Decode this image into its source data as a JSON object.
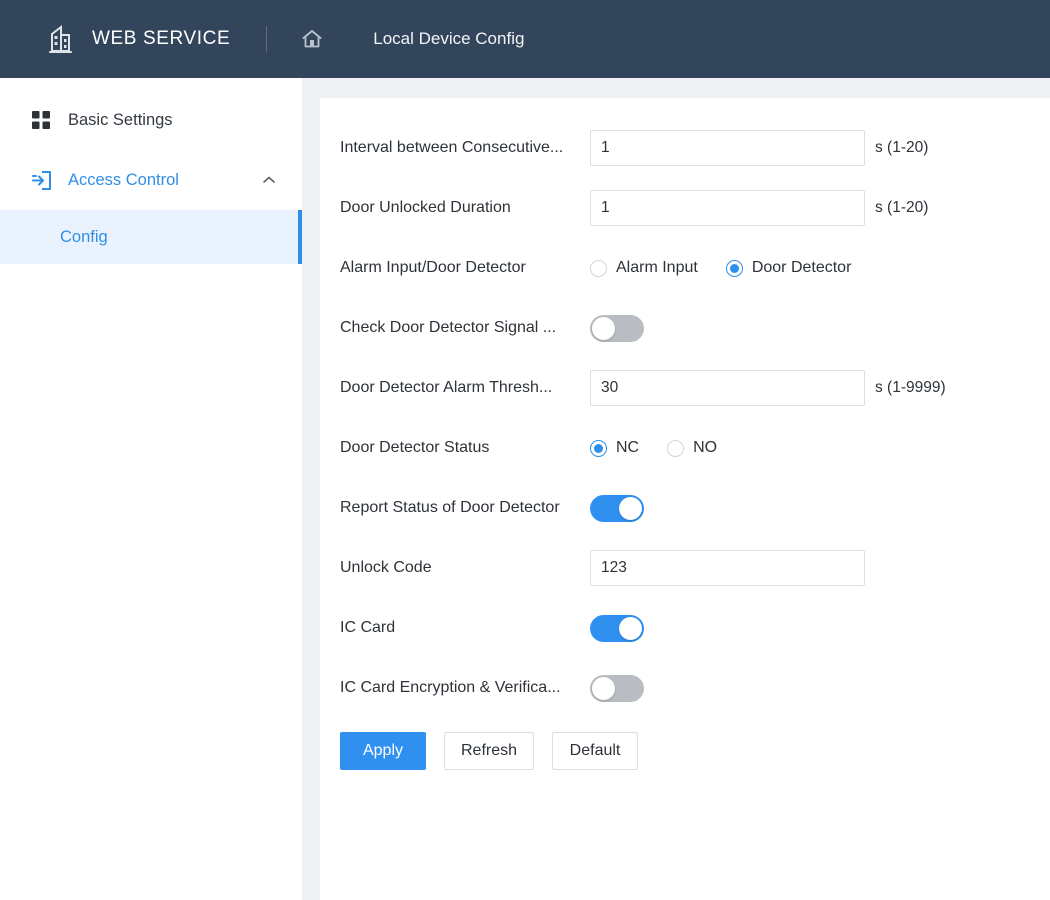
{
  "header": {
    "brand_icon": "building-icon",
    "brand_name": "WEB SERVICE",
    "home_icon": "home-icon",
    "page_title": "Local Device Config"
  },
  "sidebar": {
    "items": [
      {
        "label": "Basic Settings",
        "icon": "grid-squares-icon",
        "active": false,
        "expandable": false
      },
      {
        "label": "Access Control",
        "icon": "sign-in-box-icon",
        "active": true,
        "expandable": true,
        "chevron": "chevron-up-icon",
        "children": [
          {
            "label": "Config",
            "selected": true
          }
        ]
      }
    ]
  },
  "form": {
    "rows": [
      {
        "label": "Interval between Consecutive...",
        "type": "input",
        "value": "1",
        "unit": "s (1-20)"
      },
      {
        "label": "Door Unlocked Duration",
        "type": "input",
        "value": "1",
        "unit": "s (1-20)"
      },
      {
        "label": "Alarm Input/Door Detector",
        "type": "radio",
        "options": [
          "Alarm Input",
          "Door Detector"
        ],
        "selected": "Door Detector"
      },
      {
        "label": "Check Door Detector Signal ...",
        "type": "toggle",
        "state": "off"
      },
      {
        "label": "Door Detector Alarm Thresh...",
        "type": "input",
        "value": "30",
        "unit": "s (1-9999)"
      },
      {
        "label": "Door Detector Status",
        "type": "radio",
        "options": [
          "NC",
          "NO"
        ],
        "selected": "NC"
      },
      {
        "label": "Report Status of Door Detector",
        "type": "toggle",
        "state": "on"
      },
      {
        "label": "Unlock Code",
        "type": "input",
        "value": "123",
        "unit": ""
      },
      {
        "label": "IC Card",
        "type": "toggle",
        "state": "on"
      },
      {
        "label": "IC Card Encryption & Verifica...",
        "type": "toggle",
        "state": "off"
      }
    ],
    "buttons": {
      "apply": "Apply",
      "refresh": "Refresh",
      "default": "Default"
    }
  },
  "colors": {
    "header_bg": "#32455b",
    "accent": "#2f8fe8",
    "toggle_on": "#2f90f0",
    "toggle_off": "#b9bdc2",
    "selected_row_bg": "#eaf3fd",
    "page_bg": "#eef0f4"
  }
}
